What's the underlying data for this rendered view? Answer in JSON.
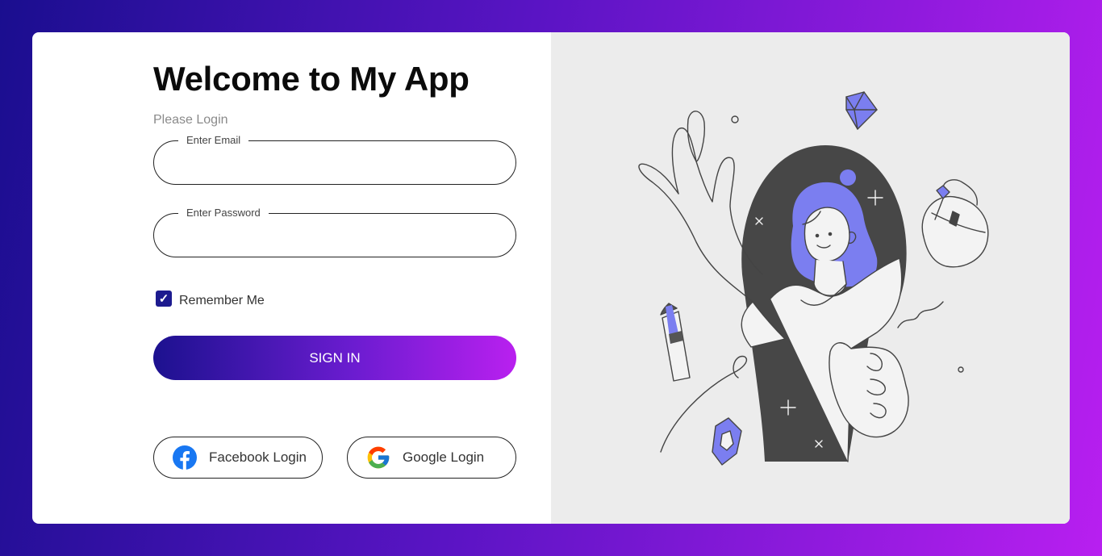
{
  "login": {
    "title": "Welcome to My App",
    "subtitle": "Please Login",
    "email_label": "Enter Email",
    "email_value": "",
    "password_label": "Enter Password",
    "password_value": "",
    "remember_label": "Remember Me",
    "remember_checked": true,
    "signin_label": "SIGN IN",
    "facebook_label": "Facebook Login",
    "google_label": "Google Login"
  },
  "icons": {
    "facebook": "facebook-icon",
    "google": "google-icon",
    "checkbox": "check-icon"
  },
  "colors": {
    "accent_start": "#1c118f",
    "accent_end": "#b920ef",
    "facebook_blue": "#1877f2",
    "illustration_purple": "#7b7ef0"
  }
}
